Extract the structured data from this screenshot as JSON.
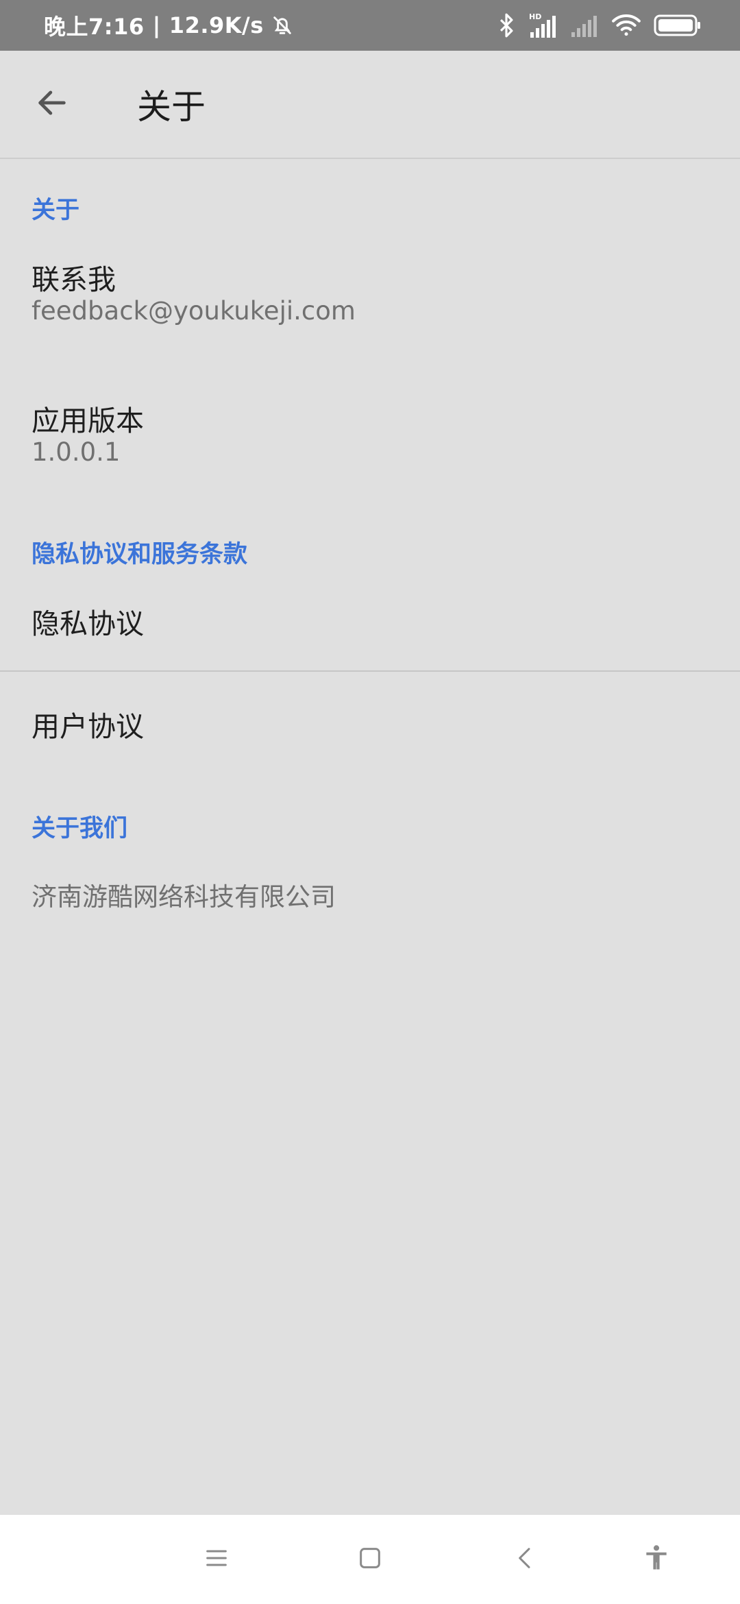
{
  "status_bar": {
    "time": "晚上7:16",
    "separator": "|",
    "speed": "12.9K/s",
    "icons": [
      "bell-off-icon",
      "bluetooth-icon",
      "hd-signal-icon",
      "signal-icon",
      "wifi-icon",
      "battery-icon"
    ]
  },
  "app_bar": {
    "back_icon": "arrow-left-icon",
    "title": "关于"
  },
  "sections": {
    "about": {
      "header": "关于",
      "contact_title": "联系我",
      "contact_value": "feedback@youkukeji.com",
      "version_title": "应用版本",
      "version_value": "1.0.0.1"
    },
    "privacy": {
      "header": "隐私协议和服务条款",
      "privacy_label": "隐私协议",
      "user_label": "用户协议"
    },
    "about_us": {
      "header": "关于我们",
      "company": "济南游酷网络科技有限公司"
    }
  },
  "nav_bar": {
    "icons": [
      "menu-icon",
      "home-icon",
      "back-icon",
      "accessibility-icon"
    ]
  },
  "colors": {
    "accent": "#3b74d9",
    "background": "#e0e0e0",
    "status_bar": "#7f7f7f"
  }
}
